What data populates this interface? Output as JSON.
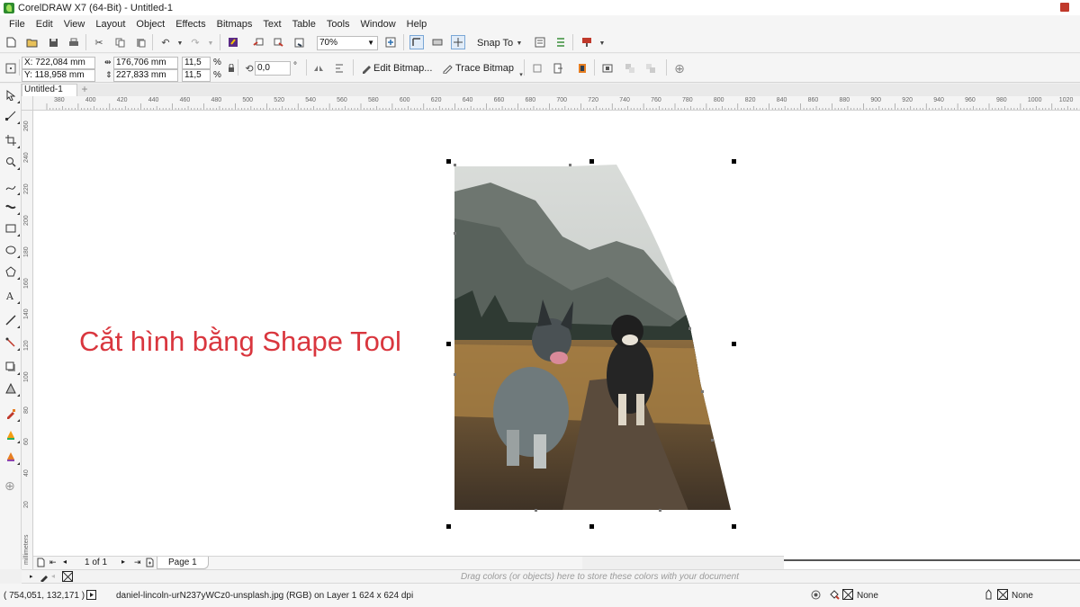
{
  "window": {
    "title": "CorelDRAW X7 (64-Bit) - Untitled-1"
  },
  "menu": [
    "File",
    "Edit",
    "View",
    "Layout",
    "Object",
    "Effects",
    "Bitmaps",
    "Text",
    "Table",
    "Tools",
    "Window",
    "Help"
  ],
  "toolbar": {
    "zoom": "70%",
    "snap_to": "Snap To"
  },
  "property_bar": {
    "x": "X: 722,084 mm",
    "y": "Y: 118,958 mm",
    "width": "176,706 mm",
    "height": "227,833 mm",
    "scale_w": "11,5",
    "scale_h": "11,5",
    "percent": "%",
    "rotation": "0,0",
    "degree": "°",
    "edit_bitmap": "Edit Bitmap...",
    "trace_bitmap": "Trace Bitmap"
  },
  "document": {
    "tab": "Untitled-1"
  },
  "ruler": {
    "h_ticks": [
      "380",
      "400",
      "420",
      "440",
      "460",
      "480",
      "500",
      "520",
      "540",
      "560",
      "580",
      "600",
      "620",
      "640",
      "660",
      "680",
      "700",
      "720",
      "740",
      "760",
      "780",
      "800",
      "820",
      "840",
      "860",
      "880",
      "900",
      "920",
      "940",
      "960",
      "980",
      "1000",
      "1020"
    ],
    "v_ticks": [
      "260",
      "240",
      "220",
      "200",
      "180",
      "160",
      "140",
      "120",
      "100",
      "80",
      "60",
      "40",
      "20"
    ],
    "unit": "millimeters"
  },
  "canvas": {
    "caption": "Cắt hình bằng Shape Tool"
  },
  "page_nav": {
    "count": "1 of 1",
    "page_tab": "Page 1"
  },
  "palette": {
    "hint": "Drag colors (or objects) here to store these colors with your document"
  },
  "status": {
    "coords": "( 754,051, 132,171 )",
    "info": "daniel-lincoln-urN237yWCz0-unsplash.jpg (RGB) on Layer 1 624 x 624 dpi",
    "fill": "None",
    "outline": "None"
  },
  "colors": {
    "caption": "#d9363e",
    "canvas": "#ffffff",
    "chrome": "#f5f5f5"
  }
}
